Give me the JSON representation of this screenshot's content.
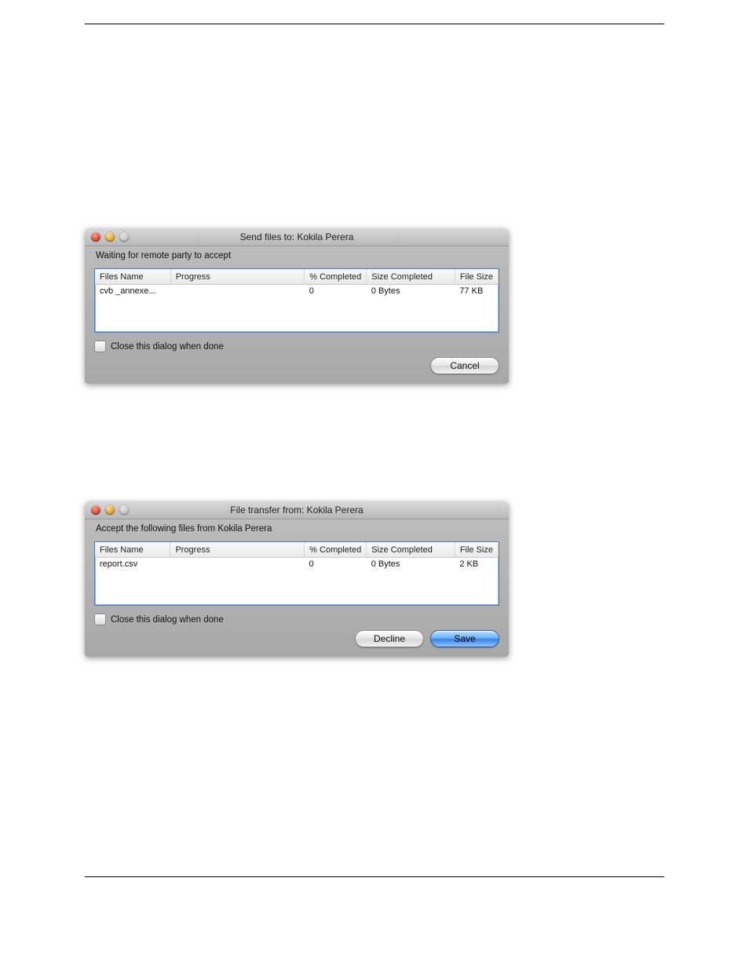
{
  "page": {},
  "dialog_send": {
    "title": "Send files to:  Kokila Perera",
    "status": "Waiting for remote party to accept",
    "columns": {
      "name": "Files Name",
      "progress": "Progress",
      "pct": "% Completed",
      "size_done": "Size Completed",
      "size": "File Size"
    },
    "row": {
      "name": "cvb _annexe...",
      "progress": "",
      "pct": "0",
      "size_done": "0 Bytes",
      "size": "77 KB"
    },
    "checkbox_label": "Close this dialog when done",
    "buttons": {
      "cancel": "Cancel"
    }
  },
  "dialog_receive": {
    "title": "File transfer from:  Kokila Perera",
    "status": "Accept the following files from  Kokila Perera",
    "columns": {
      "name": "Files Name",
      "progress": "Progress",
      "pct": "% Completed",
      "size_done": "Size Completed",
      "size": "File Size"
    },
    "row": {
      "name": "report.csv",
      "progress": "",
      "pct": "0",
      "size_done": "0 Bytes",
      "size": "2 KB"
    },
    "checkbox_label": "Close this dialog when done",
    "buttons": {
      "decline": "Decline",
      "save": "Save"
    }
  }
}
